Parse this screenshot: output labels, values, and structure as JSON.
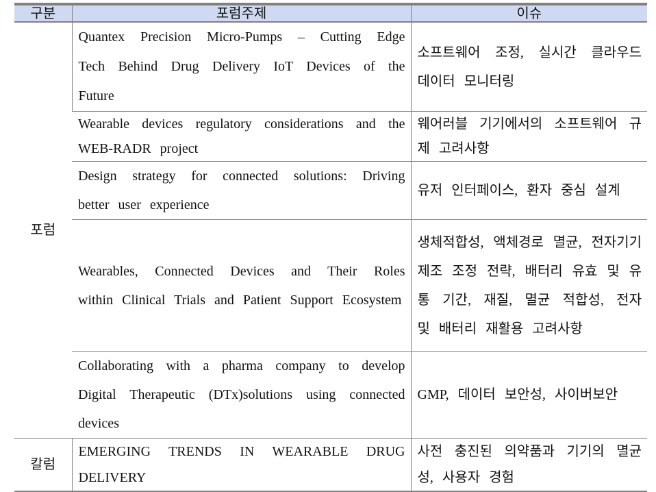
{
  "table": {
    "headers": {
      "category": "구분",
      "topic": "포럼주제",
      "issue": "이슈"
    },
    "groups": [
      {
        "category": "포럼",
        "rows": [
          {
            "topic": "Quantex Precision Micro-Pumps – Cutting Edge Tech Behind Drug Delivery IoT Devices of the Future",
            "issue": "소프트웨어 조정, 실시간 클라우드 데이터 모니터링"
          },
          {
            "topic": "Wearable devices regulatory considerations and the WEB-RADR project",
            "issue": "웨어러블 기기에서의 소프트웨어 규제 고려사항"
          },
          {
            "topic": "Design strategy for connected solutions: Driving better user experience",
            "issue": "유저 인터페이스, 환자 중심 설계"
          },
          {
            "topic": "Wearables, Connected Devices and Their Roles within Clinical Trials and Patient Support Ecosystem",
            "issue": "생체적합성, 액체경로 멸균, 전자기기 제조 조정 전략, 배터리 유효 및 유통 기간, 재질, 멸균 적합성, 전자 및 배터리 재활용 고려사항"
          },
          {
            "topic": "Collaborating with a pharma company to develop Digital Therapeutic (DTx)solutions using connected devices",
            "issue": "GMP, 데이터 보안성, 사이버보안"
          }
        ]
      },
      {
        "category": "칼럼",
        "rows": [
          {
            "topic": "EMERGING TRENDS IN WEARABLE DRUG DELIVERY",
            "issue": "사전 충진된 의약품과 기기의 멸균성, 사용자 경험"
          }
        ]
      }
    ]
  }
}
